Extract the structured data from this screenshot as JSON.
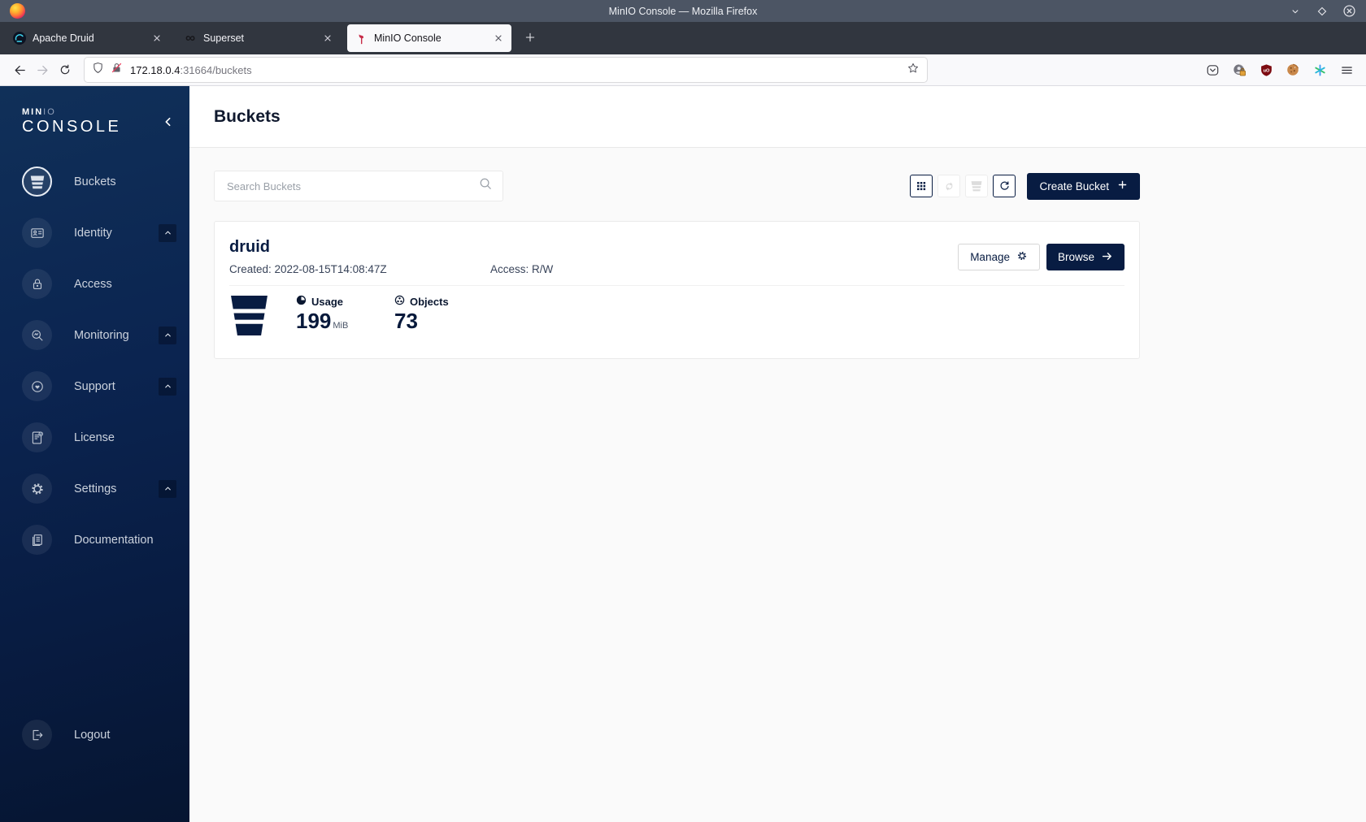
{
  "window": {
    "title": "MinIO Console — Mozilla Firefox"
  },
  "browser": {
    "tabs": [
      {
        "label": "Apache Druid",
        "icon": "druid-icon",
        "active": false
      },
      {
        "label": "Superset",
        "icon": "superset-icon",
        "active": false
      },
      {
        "label": "MinIO Console",
        "icon": "minio-flamingo-icon",
        "active": true
      }
    ],
    "url_host": "172.18.0.4",
    "url_rest": ":31664/buckets",
    "toolbar_icons": [
      "shield-icon",
      "lock-disabled-icon",
      "bookmark-star-icon",
      "pocket-icon",
      "account-lock-icon",
      "ublock-icon",
      "cookie-icon",
      "asterisk-icon",
      "menu-icon"
    ]
  },
  "sidebar": {
    "logo_bold": "MIN",
    "logo_light": "IO",
    "logo_sub": "CONSOLE",
    "items": [
      {
        "label": "Buckets",
        "icon": "bucket-icon",
        "active": true,
        "expandable": false
      },
      {
        "label": "Identity",
        "icon": "identity-card-icon",
        "active": false,
        "expandable": true
      },
      {
        "label": "Access",
        "icon": "lock-icon",
        "active": false,
        "expandable": false
      },
      {
        "label": "Monitoring",
        "icon": "magnifier-gauge-icon",
        "active": false,
        "expandable": true
      },
      {
        "label": "Support",
        "icon": "support-heart-icon",
        "active": false,
        "expandable": true
      },
      {
        "label": "License",
        "icon": "license-doc-icon",
        "active": false,
        "expandable": false
      },
      {
        "label": "Settings",
        "icon": "gear-icon",
        "active": false,
        "expandable": true
      },
      {
        "label": "Documentation",
        "icon": "book-icon",
        "active": false,
        "expandable": false
      }
    ],
    "logout": {
      "label": "Logout",
      "icon": "logout-icon"
    }
  },
  "page": {
    "title": "Buckets",
    "search_placeholder": "Search Buckets",
    "create_button_label": "Create Bucket"
  },
  "bucket_card": {
    "name": "druid",
    "created": "Created: 2022-08-15T14:08:47Z",
    "access": "Access: R/W",
    "usage_label": "Usage",
    "usage_value": "199",
    "usage_unit": "MiB",
    "objects_label": "Objects",
    "objects_value": "73",
    "manage_label": "Manage",
    "browse_label": "Browse"
  },
  "colors": {
    "brand_navy": "#081C42",
    "minio_red": "#C72C48",
    "sidebar_gradient_top": "#103059",
    "sidebar_gradient_bottom": "#061531",
    "titlebar": "#4C5564",
    "tabbar": "#31363F",
    "toolbar_bg": "#F9F9FB",
    "content_bg": "#FAFAFA"
  }
}
